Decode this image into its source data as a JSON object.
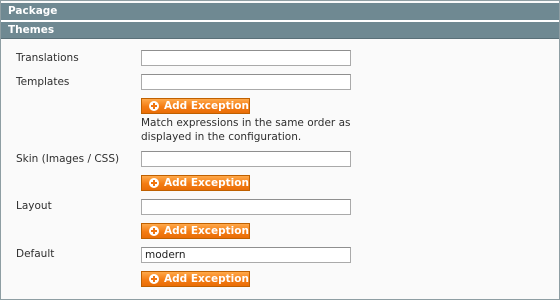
{
  "sections": {
    "package": "Package",
    "themes": "Themes"
  },
  "fields": {
    "translations": {
      "label": "Translations",
      "value": ""
    },
    "templates": {
      "label": "Templates",
      "value": ""
    },
    "skin": {
      "label": "Skin (Images / CSS)",
      "value": ""
    },
    "layout": {
      "label": "Layout",
      "value": ""
    },
    "default": {
      "label": "Default",
      "value": "modern"
    }
  },
  "add_exception_label": "Add Exception",
  "templates_note": "Match expressions in the same order as displayed in the configuration.",
  "colors": {
    "header_bg": "#6f8992",
    "button_orange": "#f47c13"
  }
}
